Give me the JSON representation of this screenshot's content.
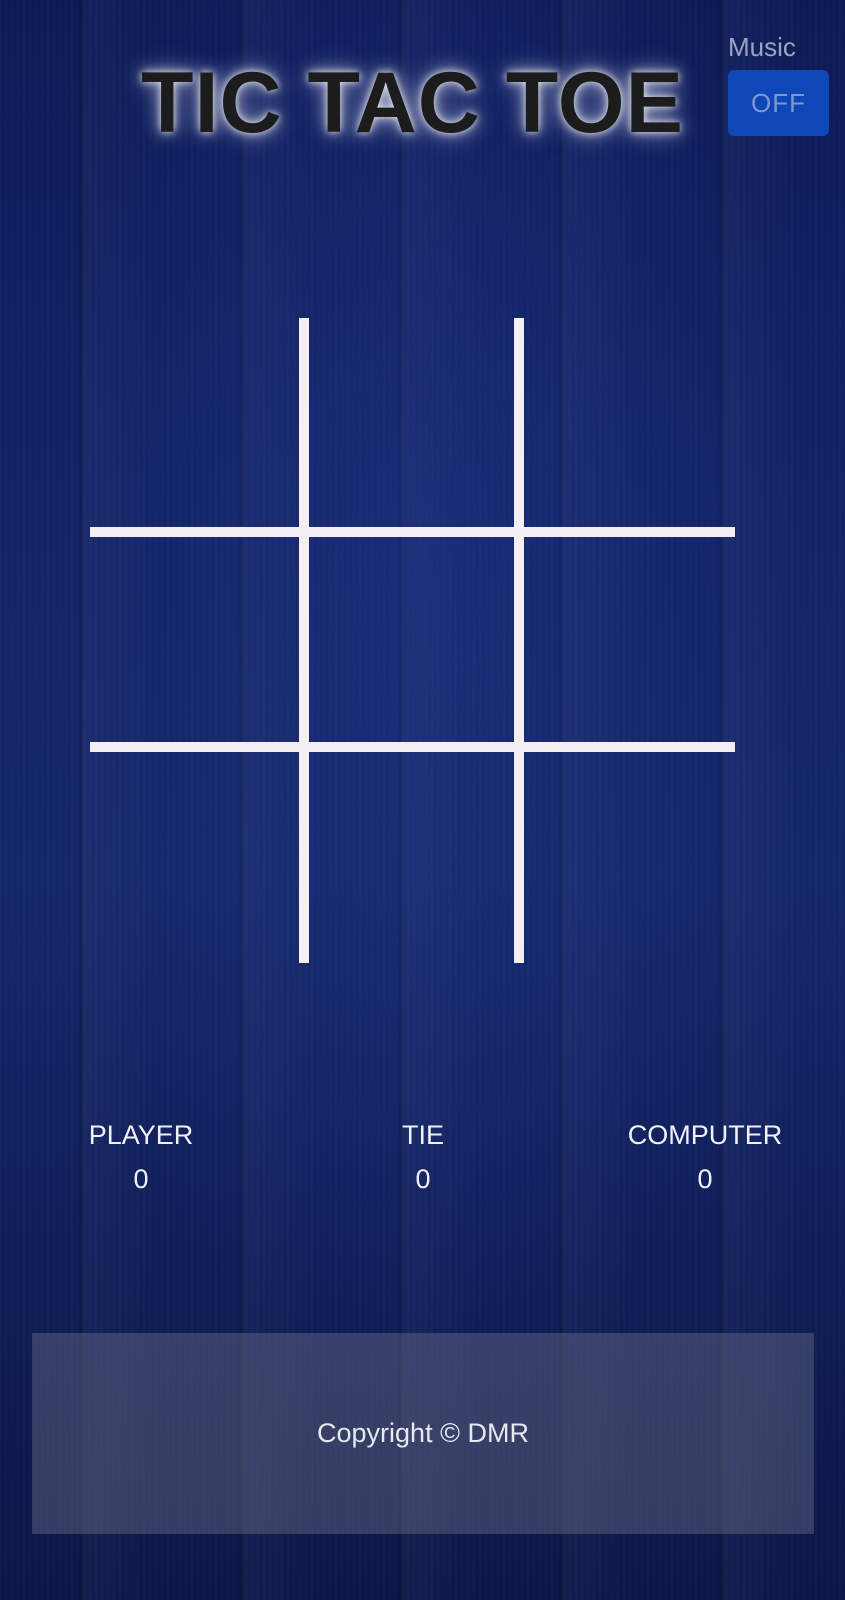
{
  "header": {
    "title": "TIC TAC TOE",
    "music_label": "Music",
    "music_toggle": "OFF"
  },
  "board": {
    "cells": [
      "",
      "",
      "",
      "",
      "",
      "",
      "",
      "",
      ""
    ]
  },
  "scores": {
    "player_label": "PLAYER",
    "player_value": "0",
    "tie_label": "TIE",
    "tie_value": "0",
    "computer_label": "COMPUTER",
    "computer_value": "0"
  },
  "footer": {
    "copyright": "Copyright © DMR"
  },
  "colors": {
    "background": "#112367",
    "grid_line": "#f5eef2",
    "toggle": "#0d47b8"
  }
}
